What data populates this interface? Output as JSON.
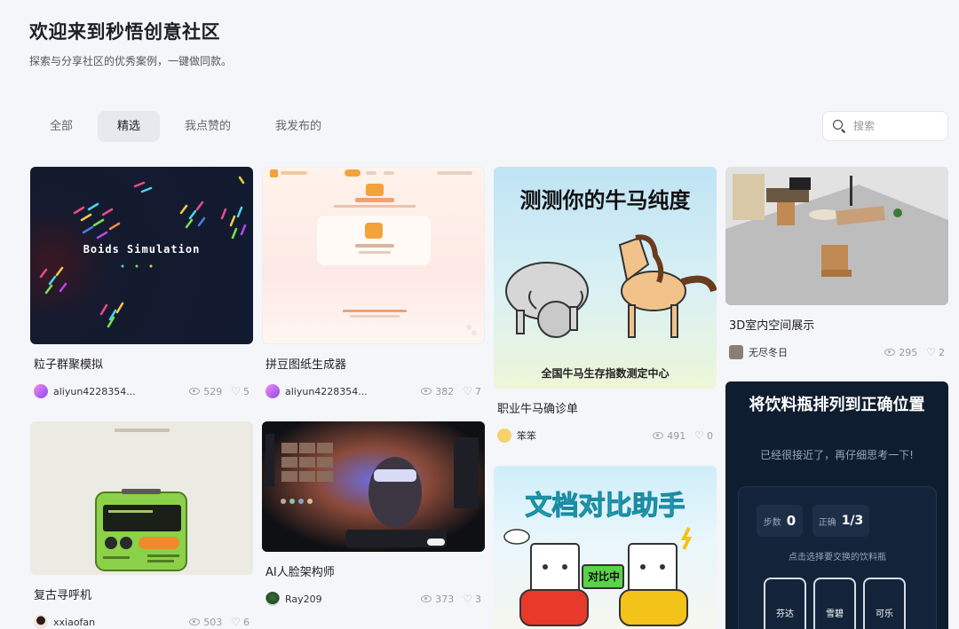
{
  "header": {
    "title": "欢迎来到秒悟创意社区",
    "subtitle": "探索与分享社区的优秀案例，一键做同款。"
  },
  "tabs": [
    {
      "label": "全部"
    },
    {
      "label": "精选"
    },
    {
      "label": "我点赞的"
    },
    {
      "label": "我发布的"
    }
  ],
  "search": {
    "placeholder": "搜索"
  },
  "cards": [
    {
      "title": "粒子群聚模拟",
      "author": "aliyun4228354...",
      "views": "529",
      "likes": "5",
      "thumb_text": "Boids Simulation"
    },
    {
      "title": "拼豆图纸生成器",
      "author": "aliyun4228354...",
      "views": "382",
      "likes": "7"
    },
    {
      "title": "职业牛马确诊单",
      "author": "笨笨",
      "views": "491",
      "likes": "0",
      "thumb_text": "测测你的牛马纯度",
      "thumb_sub": "全国牛马生存指数测定中心"
    },
    {
      "title": "3D室内空间展示",
      "author": "无尽冬日",
      "views": "295",
      "likes": "2"
    },
    {
      "title": "复古寻呼机",
      "author": "xxiaofan",
      "views": "503",
      "likes": "6"
    },
    {
      "title": "AI人脸架构师",
      "author": "Ray209",
      "views": "373",
      "likes": "3"
    },
    {
      "thumb_text": "文档对比助手",
      "thumb_sub": "对比中"
    },
    {
      "thumb_text": "将饮料瓶排列到正确位置",
      "thumb_sub": "已经很接近了，再仔细思考一下!",
      "steps_label": "步数",
      "steps_value": "0",
      "correct_label": "正确",
      "correct_value": "1/3",
      "hint": "点击选择要交换的饮料瓶",
      "bottles": [
        "芬达",
        "雪碧",
        "可乐"
      ]
    }
  ],
  "colors": {
    "background": "#f5f6fa",
    "active_tab": "#e7e9ee"
  }
}
